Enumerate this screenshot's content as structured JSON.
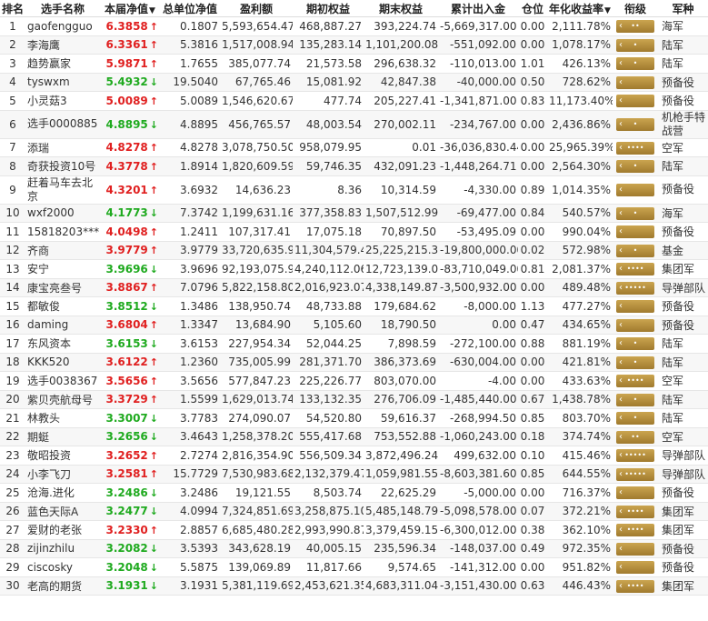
{
  "headers": {
    "rank": "排名",
    "name": "选手名称",
    "nav": "本届净值",
    "total_nav": "总单位净值",
    "profit": "盈利额",
    "start_equity": "期初权益",
    "end_equity": "期末权益",
    "cum_flow": "累计出入金",
    "position": "仓位",
    "annual": "年化收益率",
    "sort_icon": "▼",
    "rank_title": "衔级",
    "army": "军种"
  },
  "colors": {
    "up": "#e02020",
    "down": "#1faa1f",
    "badge": "#b08d3f"
  },
  "rows": [
    {
      "rank": "1",
      "name": "gaofengguo",
      "nav": "6.3858",
      "dir": "up",
      "total": "0.1807",
      "profit": "5,593,654.47",
      "start": "468,887.27",
      "end": "393,224.74",
      "flow": "-5,669,317.00",
      "pos": "0.00",
      "annual": "2,111.78%",
      "badge": "••",
      "army": "海军"
    },
    {
      "rank": "2",
      "name": "李海鹰",
      "nav": "6.3361",
      "dir": "up",
      "total": "5.3816",
      "profit": "1,517,008.94",
      "start": "135,283.14",
      "end": "1,101,200.08",
      "flow": "-551,092.00",
      "pos": "0.00",
      "annual": "1,078.17%",
      "badge": "•",
      "army": "陆军"
    },
    {
      "rank": "3",
      "name": "趋势赢家",
      "nav": "5.9871",
      "dir": "up",
      "total": "1.7655",
      "profit": "385,077.74",
      "start": "21,573.58",
      "end": "296,638.32",
      "flow": "-110,013.00",
      "pos": "1.01",
      "annual": "426.13%",
      "badge": "•",
      "army": "陆军"
    },
    {
      "rank": "4",
      "name": "tyswxm",
      "nav": "5.4932",
      "dir": "down",
      "total": "19.5040",
      "profit": "67,765.46",
      "start": "15,081.92",
      "end": "42,847.38",
      "flow": "-40,000.00",
      "pos": "0.50",
      "annual": "728.62%",
      "badge": "",
      "army": "预备役"
    },
    {
      "rank": "5",
      "name": "小灵菇3",
      "nav": "5.0089",
      "dir": "up",
      "total": "5.0089",
      "profit": "1,546,620.67",
      "start": "477.74",
      "end": "205,227.41",
      "flow": "-1,341,871.00",
      "pos": "0.83",
      "annual": "11,173.40%",
      "badge": "",
      "army": "预备役"
    },
    {
      "rank": "6",
      "name": "选手0000885",
      "nav": "4.8895",
      "dir": "down",
      "total": "4.8895",
      "profit": "456,765.57",
      "start": "48,003.54",
      "end": "270,002.11",
      "flow": "-234,767.00",
      "pos": "0.00",
      "annual": "2,436.86%",
      "badge": "•",
      "army": "机枪手特战营",
      "tall": true
    },
    {
      "rank": "7",
      "name": "添瑞",
      "nav": "4.8278",
      "dir": "up",
      "total": "4.8278",
      "profit": "3,078,750.50",
      "start": "958,079.95",
      "end": "0.01",
      "flow": "-36,036,830.44",
      "pos": "0.00",
      "annual": "25,965.39%",
      "badge": "••••",
      "army": "空军"
    },
    {
      "rank": "8",
      "name": "奇获投资10号",
      "nav": "4.3778",
      "dir": "up",
      "total": "1.8914",
      "profit": "1,820,609.59",
      "start": "59,746.35",
      "end": "432,091.23",
      "flow": "-1,448,264.71",
      "pos": "0.00",
      "annual": "2,564.30%",
      "badge": "•",
      "army": "陆军"
    },
    {
      "rank": "9",
      "name": "赶着马车去北京",
      "nav": "4.3201",
      "dir": "up",
      "total": "3.6932",
      "profit": "14,636.23",
      "start": "8.36",
      "end": "10,314.59",
      "flow": "-4,330.00",
      "pos": "0.89",
      "annual": "1,014.35%",
      "badge": "",
      "army": "预备役",
      "tall": true
    },
    {
      "rank": "10",
      "name": "wxf2000",
      "nav": "4.1773",
      "dir": "down",
      "total": "7.3742",
      "profit": "1,199,631.16",
      "start": "377,358.83",
      "end": "1,507,512.99",
      "flow": "-69,477.00",
      "pos": "0.84",
      "annual": "540.57%",
      "badge": "•",
      "army": "海军"
    },
    {
      "rank": "11",
      "name": "15818203***",
      "nav": "4.0498",
      "dir": "up",
      "total": "1.2411",
      "profit": "107,317.41",
      "start": "17,075.18",
      "end": "70,897.50",
      "flow": "-53,495.09",
      "pos": "0.00",
      "annual": "990.04%",
      "badge": "",
      "army": "预备役"
    },
    {
      "rank": "12",
      "name": "齐商",
      "nav": "3.9779",
      "dir": "up",
      "total": "3.9779",
      "profit": "33,720,635.94",
      "start": "11,304,579.40",
      "end": "25,225,215.34",
      "flow": "-19,800,000.00",
      "pos": "0.02",
      "annual": "572.98%",
      "badge": "•",
      "army": "基金"
    },
    {
      "rank": "13",
      "name": "安宁",
      "nav": "3.9696",
      "dir": "down",
      "total": "3.9696",
      "profit": "92,193,075.99",
      "start": "4,240,112.06",
      "end": "12,723,139.05",
      "flow": "-83,710,049.00",
      "pos": "0.81",
      "annual": "2,081.37%",
      "badge": "••••",
      "army": "集团军"
    },
    {
      "rank": "14",
      "name": "康宝亮叁号",
      "nav": "3.8867",
      "dir": "up",
      "total": "7.0796",
      "profit": "5,822,158.80",
      "start": "2,016,923.07",
      "end": "4,338,149.87",
      "flow": "-3,500,932.00",
      "pos": "0.00",
      "annual": "489.48%",
      "badge": "•••••",
      "army": "导弹部队"
    },
    {
      "rank": "15",
      "name": "都敏俊",
      "nav": "3.8512",
      "dir": "down",
      "total": "1.3486",
      "profit": "138,950.74",
      "start": "48,733.88",
      "end": "179,684.62",
      "flow": "-8,000.00",
      "pos": "1.13",
      "annual": "477.27%",
      "badge": "",
      "army": "预备役"
    },
    {
      "rank": "16",
      "name": "daming",
      "nav": "3.6804",
      "dir": "up",
      "total": "1.3347",
      "profit": "13,684.90",
      "start": "5,105.60",
      "end": "18,790.50",
      "flow": "0.00",
      "pos": "0.47",
      "annual": "434.65%",
      "badge": "",
      "army": "预备役"
    },
    {
      "rank": "17",
      "name": "东风资本",
      "nav": "3.6153",
      "dir": "down",
      "total": "3.6153",
      "profit": "227,954.34",
      "start": "52,044.25",
      "end": "7,898.59",
      "flow": "-272,100.00",
      "pos": "0.88",
      "annual": "881.19%",
      "badge": "•",
      "army": "陆军"
    },
    {
      "rank": "18",
      "name": "KKK520",
      "nav": "3.6122",
      "dir": "up",
      "total": "1.2360",
      "profit": "735,005.99",
      "start": "281,371.70",
      "end": "386,373.69",
      "flow": "-630,004.00",
      "pos": "0.00",
      "annual": "421.81%",
      "badge": "•",
      "army": "陆军"
    },
    {
      "rank": "19",
      "name": "选手0038367",
      "nav": "3.5656",
      "dir": "up",
      "total": "3.5656",
      "profit": "577,847.23",
      "start": "225,226.77",
      "end": "803,070.00",
      "flow": "-4.00",
      "pos": "0.00",
      "annual": "433.63%",
      "badge": "••••",
      "army": "空军"
    },
    {
      "rank": "20",
      "name": "紫贝壳航母号",
      "nav": "3.3729",
      "dir": "up",
      "total": "1.5599",
      "profit": "1,629,013.74",
      "start": "133,132.35",
      "end": "276,706.09",
      "flow": "-1,485,440.00",
      "pos": "0.67",
      "annual": "1,438.78%",
      "badge": "•",
      "army": "陆军"
    },
    {
      "rank": "21",
      "name": "林教头",
      "nav": "3.3007",
      "dir": "down",
      "total": "3.7783",
      "profit": "274,090.07",
      "start": "54,520.80",
      "end": "59,616.37",
      "flow": "-268,994.50",
      "pos": "0.85",
      "annual": "803.70%",
      "badge": "•",
      "army": "陆军"
    },
    {
      "rank": "22",
      "name": "期蜓",
      "nav": "3.2656",
      "dir": "down",
      "total": "3.4643",
      "profit": "1,258,378.20",
      "start": "555,417.68",
      "end": "753,552.88",
      "flow": "-1,060,243.00",
      "pos": "0.18",
      "annual": "374.74%",
      "badge": "••",
      "army": "空军"
    },
    {
      "rank": "23",
      "name": "敬昭投资",
      "nav": "3.2652",
      "dir": "up",
      "total": "2.7274",
      "profit": "2,816,354.90",
      "start": "556,509.34",
      "end": "3,872,496.24",
      "flow": "499,632.00",
      "pos": "0.10",
      "annual": "415.46%",
      "badge": "•••••",
      "army": "导弹部队"
    },
    {
      "rank": "24",
      "name": "小李飞刀",
      "nav": "3.2581",
      "dir": "up",
      "total": "15.7729",
      "profit": "7,530,983.68",
      "start": "2,132,379.47",
      "end": "1,059,981.55",
      "flow": "-8,603,381.60",
      "pos": "0.85",
      "annual": "644.55%",
      "badge": "•••••",
      "army": "导弹部队"
    },
    {
      "rank": "25",
      "name": "沧海.进化",
      "nav": "3.2486",
      "dir": "down",
      "total": "3.2486",
      "profit": "19,121.55",
      "start": "8,503.74",
      "end": "22,625.29",
      "flow": "-5,000.00",
      "pos": "0.00",
      "annual": "716.37%",
      "badge": "",
      "army": "预备役"
    },
    {
      "rank": "26",
      "name": "蓝色天际A",
      "nav": "3.2477",
      "dir": "down",
      "total": "4.0994",
      "profit": "7,324,851.69",
      "start": "3,258,875.10",
      "end": "5,485,148.79",
      "flow": "-5,098,578.00",
      "pos": "0.07",
      "annual": "372.21%",
      "badge": "••••",
      "army": "集团军"
    },
    {
      "rank": "27",
      "name": "爱财的老张",
      "nav": "3.2330",
      "dir": "up",
      "total": "2.8857",
      "profit": "6,685,480.28",
      "start": "2,993,990.87",
      "end": "3,379,459.15",
      "flow": "-6,300,012.00",
      "pos": "0.38",
      "annual": "362.10%",
      "badge": "••••",
      "army": "集团军"
    },
    {
      "rank": "28",
      "name": "zijinzhilu",
      "nav": "3.2082",
      "dir": "down",
      "total": "3.5393",
      "profit": "343,628.19",
      "start": "40,005.15",
      "end": "235,596.34",
      "flow": "-148,037.00",
      "pos": "0.49",
      "annual": "972.35%",
      "badge": "",
      "army": "预备役"
    },
    {
      "rank": "29",
      "name": "ciscosky",
      "nav": "3.2048",
      "dir": "down",
      "total": "5.5875",
      "profit": "139,069.89",
      "start": "11,817.66",
      "end": "9,574.65",
      "flow": "-141,312.00",
      "pos": "0.00",
      "annual": "951.82%",
      "badge": "",
      "army": "预备役"
    },
    {
      "rank": "30",
      "name": "老高的期货",
      "nav": "3.1931",
      "dir": "down",
      "total": "3.1931",
      "profit": "5,381,119.69",
      "start": "2,453,621.35",
      "end": "4,683,311.04",
      "flow": "-3,151,430.00",
      "pos": "0.63",
      "annual": "446.43%",
      "badge": "••••",
      "army": "集团军"
    }
  ]
}
